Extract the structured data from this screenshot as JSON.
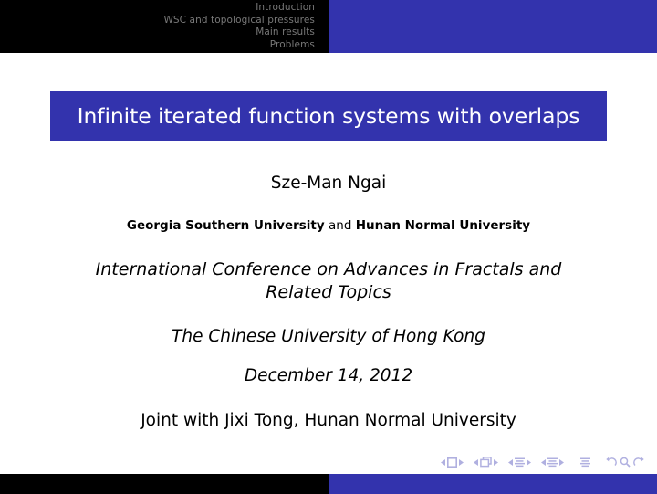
{
  "slide": {
    "type": "beamer-title-slide",
    "colors": {
      "bar_blue": "#3333ad",
      "bar_black": "#000000",
      "nav_text_gray": "#787878",
      "title_text": "#ffffff",
      "body_text": "#000000",
      "navsym_blue": "#b0b0e0"
    }
  },
  "header": {
    "nav_items": [
      {
        "label": "Introduction"
      },
      {
        "label": "WSC and topological pressures"
      },
      {
        "label": "Main results"
      },
      {
        "label": "Problems"
      }
    ]
  },
  "title": {
    "text": "Infinite iterated function systems with overlaps"
  },
  "body": {
    "author": "Sze-Man Ngai",
    "institute": {
      "first": "Georgia Southern University",
      "conjunction": "and",
      "second": "Hunan Normal University"
    },
    "conference": "International Conference on Advances in Fractals and Related Topics",
    "venue": "The Chinese University of Hong Kong",
    "date": "December 14, 2012",
    "joint_with": "Joint with Jixi Tong, Hunan Normal University"
  },
  "navigation_symbols": {
    "groups": [
      {
        "name": "slide",
        "icon": "square-icon"
      },
      {
        "name": "frame",
        "icon": "stacked-squares-icon"
      },
      {
        "name": "subsection",
        "icon": "lines-icon"
      },
      {
        "name": "section",
        "icon": "lines-icon"
      },
      {
        "name": "presentation",
        "icon": "document-lines-icon"
      }
    ],
    "doc_controls": [
      {
        "name": "back",
        "icon": "back-arrow-icon"
      },
      {
        "name": "find",
        "icon": "magnifier-icon"
      },
      {
        "name": "forward",
        "icon": "forward-arrow-icon"
      }
    ]
  },
  "footer": {
    "left_color": "#000000",
    "right_color": "#3333ad"
  }
}
